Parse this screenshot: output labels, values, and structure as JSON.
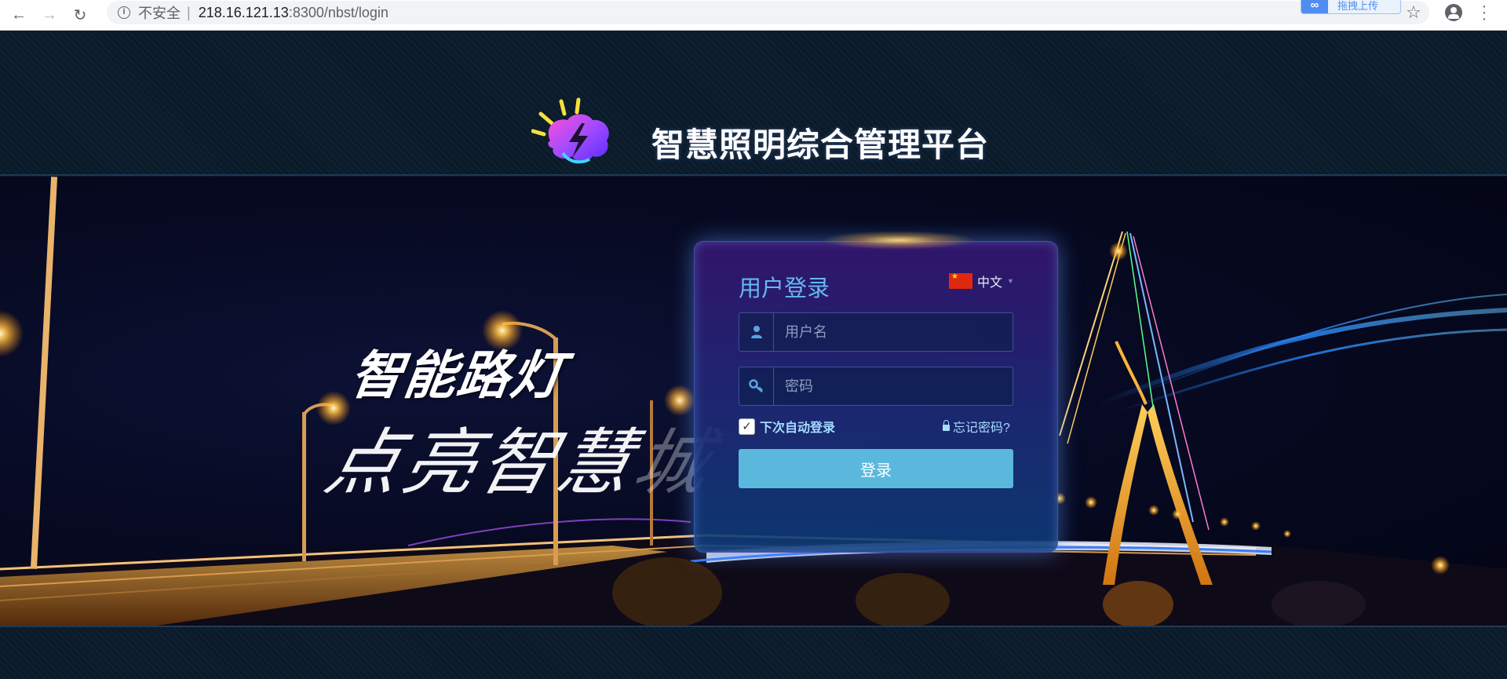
{
  "browser": {
    "security_label": "不安全",
    "separator": "|",
    "url_host": "218.16.121.13",
    "url_path": ":8300/nbst/login",
    "extension_label": "拖拽上传",
    "icons": [
      "back-icon",
      "forward-icon",
      "reload-icon",
      "info-icon",
      "star-icon",
      "account-icon",
      "menu-icon"
    ]
  },
  "header": {
    "site_title": "智慧照明综合管理平台"
  },
  "hero": {
    "slogan_main": "智能路灯",
    "slogan_script": "点亮智慧",
    "slogan_script_faded": "城"
  },
  "login": {
    "title": "用户登录",
    "language": "中文",
    "username_placeholder": "用户名",
    "password_placeholder": "密码",
    "remember_label": "下次自动登录",
    "remember_checked": true,
    "forgot_label": "忘记密码?",
    "submit_label": "登录"
  },
  "colors": {
    "page_bg": "#0a1826",
    "title_blue": "#66b8f0",
    "button_blue": "#5ab8dc",
    "link_blue": "#a6dcff"
  }
}
